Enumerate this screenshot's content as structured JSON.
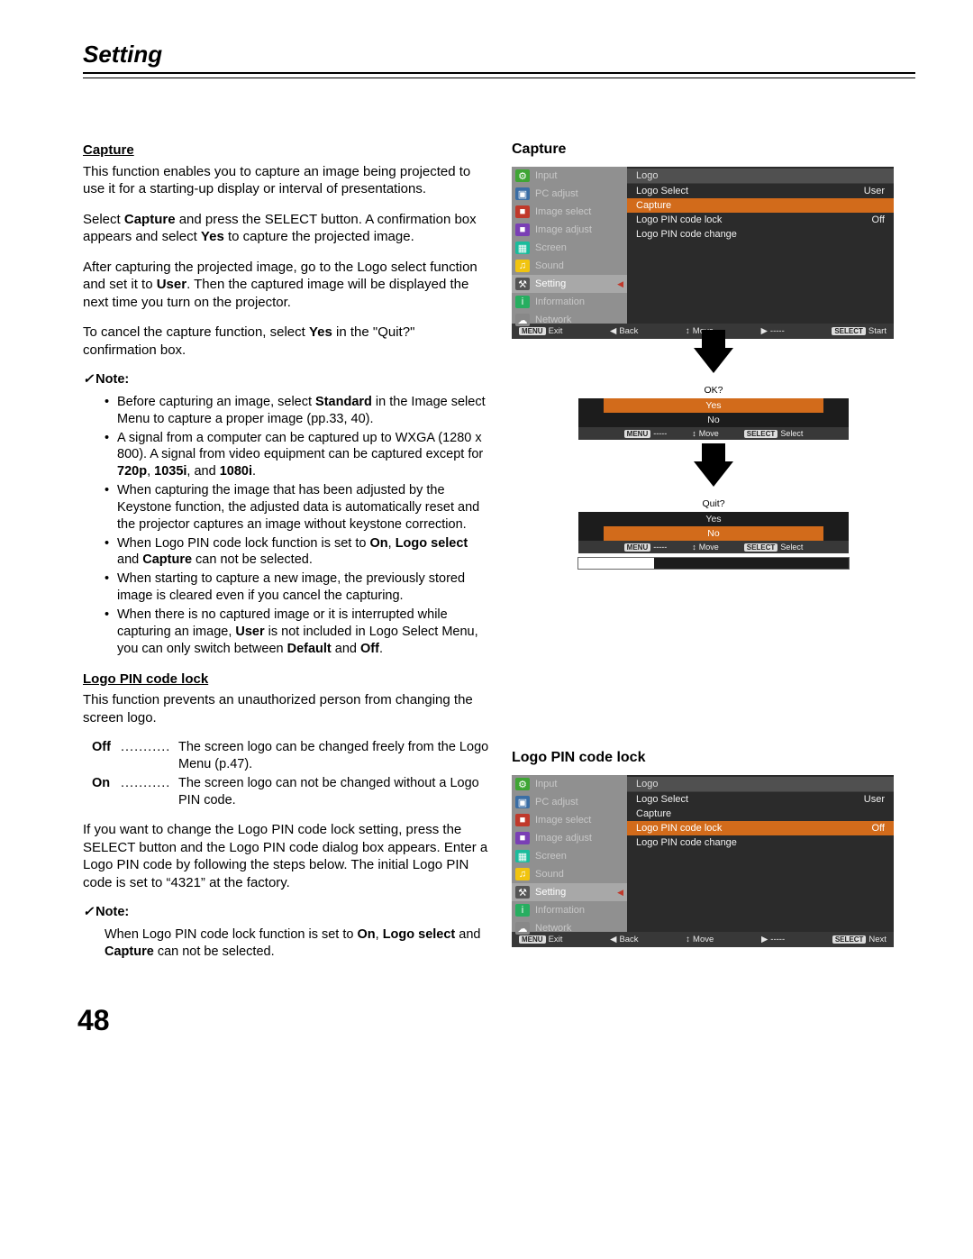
{
  "page": {
    "title": "Setting",
    "number": "48"
  },
  "left": {
    "capture_h": "Capture",
    "capture_p1": "This function enables you to capture an image being projected to use it for a starting-up display or interval of presentations.",
    "capture_p2_a": "Select ",
    "capture_p2_b": "Capture",
    "capture_p2_c": " and press the SELECT button. A confirmation box appears and select ",
    "capture_p2_d": "Yes",
    "capture_p2_e": " to capture the projected image.",
    "capture_p3_a": "After capturing the projected image, go to the Logo select function and set it to ",
    "capture_p3_b": "User",
    "capture_p3_c": ". Then the captured image will be displayed the next time you turn on the projector.",
    "capture_p4_a": "To cancel the capture function, select ",
    "capture_p4_b": "Yes",
    "capture_p4_c": " in the \"Quit?\" confirmation box.",
    "note1_h": "Note:",
    "note1_i1_a": "Before capturing an image, select ",
    "note1_i1_b": "Standard",
    "note1_i1_c": " in the Image select Menu to capture a proper image (pp.33, 40).",
    "note1_i2_a": "A signal from a computer can be captured up to WXGA (1280 x 800). A signal from video equipment can be captured except for ",
    "note1_i2_b": "720p",
    "note1_i2_c": ", ",
    "note1_i2_d": "1035i",
    "note1_i2_e": ", and ",
    "note1_i2_f": "1080i",
    "note1_i2_g": ".",
    "note1_i3": "When capturing the image that has been adjusted by the Keystone function, the adjusted data is automatically reset and the projector captures an image without keystone correction.",
    "note1_i4_a": "When Logo PIN code lock function is set to ",
    "note1_i4_b": "On",
    "note1_i4_c": ", ",
    "note1_i4_d": "Logo select",
    "note1_i4_e": " and ",
    "note1_i4_f": "Capture",
    "note1_i4_g": " can not be selected.",
    "note1_i5": "When starting to capture a new image, the previously stored image is cleared even if you cancel the capturing.",
    "note1_i6_a": "When there is no captured image or it is interrupted while capturing an image, ",
    "note1_i6_b": "User",
    "note1_i6_c": " is not included in Logo Select Menu, you can only switch between ",
    "note1_i6_d": "Default",
    "note1_i6_e": " and ",
    "note1_i6_f": "Off",
    "note1_i6_g": ".",
    "pin_h": "Logo PIN code lock",
    "pin_p1": "This function prevents an unauthorized person from changing the screen logo.",
    "pin_off_k": "Off",
    "pin_off_v": "The screen logo can be changed freely from the Logo Menu (p.47).",
    "pin_on_k": "On",
    "pin_on_v": "The screen logo can not be changed without a Logo PIN code.",
    "pin_p2": "If you want to change the Logo PIN code lock setting, press the SELECT button and the Logo PIN code dialog box appears. Enter a Logo PIN code by following the steps below. The initial Logo PIN code is set to “4321” at the factory.",
    "note2_h": "Note:",
    "note2_b_a": "When Logo PIN code lock function is set to ",
    "note2_b_b": "On",
    "note2_b_c": ", ",
    "note2_b_d": "Logo select",
    "note2_b_e": " and ",
    "note2_b_f": "Capture",
    "note2_b_g": " can not be selected."
  },
  "right": {
    "capture_h": "Capture",
    "logo_h": "Logo PIN code lock"
  },
  "sidebar": [
    {
      "name": "Input",
      "icon": "⚙",
      "color": "#3fa535"
    },
    {
      "name": "PC adjust",
      "icon": "▣",
      "color": "#3b6ea5"
    },
    {
      "name": "Image select",
      "icon": "■",
      "color": "#c0392b"
    },
    {
      "name": "Image adjust",
      "icon": "■",
      "color": "#7a3fb5"
    },
    {
      "name": "Screen",
      "icon": "▦",
      "color": "#1abc9c"
    },
    {
      "name": "Sound",
      "icon": "♫",
      "color": "#f1c40f"
    },
    {
      "name": "Setting",
      "icon": "⚒",
      "color": "#555"
    },
    {
      "name": "Information",
      "icon": "i",
      "color": "#27ae60"
    },
    {
      "name": "Network",
      "icon": "☁",
      "color": "#888"
    }
  ],
  "menu1": {
    "header": "Logo",
    "rows": [
      {
        "l": "Logo Select",
        "r": "User"
      },
      {
        "l": "Capture",
        "r": "",
        "hl": true
      },
      {
        "l": "Logo PIN code lock",
        "r": "Off"
      },
      {
        "l": "Logo PIN code change",
        "r": ""
      }
    ],
    "help": {
      "exit_pill": "MENU",
      "exit": "Exit",
      "back_ic": "◀",
      "back": "Back",
      "move_ic": "↕",
      "move": "Move",
      "next_ic": "▶",
      "next": "-----",
      "sel_pill": "SELECT",
      "sel": "Start"
    }
  },
  "menu2": {
    "header": "Logo",
    "rows": [
      {
        "l": "Logo Select",
        "r": "User"
      },
      {
        "l": "Capture",
        "r": ""
      },
      {
        "l": "Logo PIN code lock",
        "r": "Off",
        "hl": true
      },
      {
        "l": "Logo PIN code change",
        "r": ""
      }
    ],
    "help": {
      "exit_pill": "MENU",
      "exit": "Exit",
      "back_ic": "◀",
      "back": "Back",
      "move_ic": "↕",
      "move": "Move",
      "next_ic": "▶",
      "next": "-----",
      "sel_pill": "SELECT",
      "sel": "Next"
    }
  },
  "confirm1": {
    "title": "OK?",
    "yes": "Yes",
    "no": "No",
    "help_menu_pill": "MENU",
    "help_menu": "-----",
    "help_move_ic": "↕",
    "help_move": "Move",
    "help_sel_pill": "SELECT",
    "help_sel": "Select"
  },
  "confirm2": {
    "title": "Quit?",
    "yes": "Yes",
    "no": "No",
    "help_menu_pill": "MENU",
    "help_menu": "-----",
    "help_move_ic": "↕",
    "help_move": "Move",
    "help_sel_pill": "SELECT",
    "help_sel": "Select"
  },
  "progress_pct": 28
}
